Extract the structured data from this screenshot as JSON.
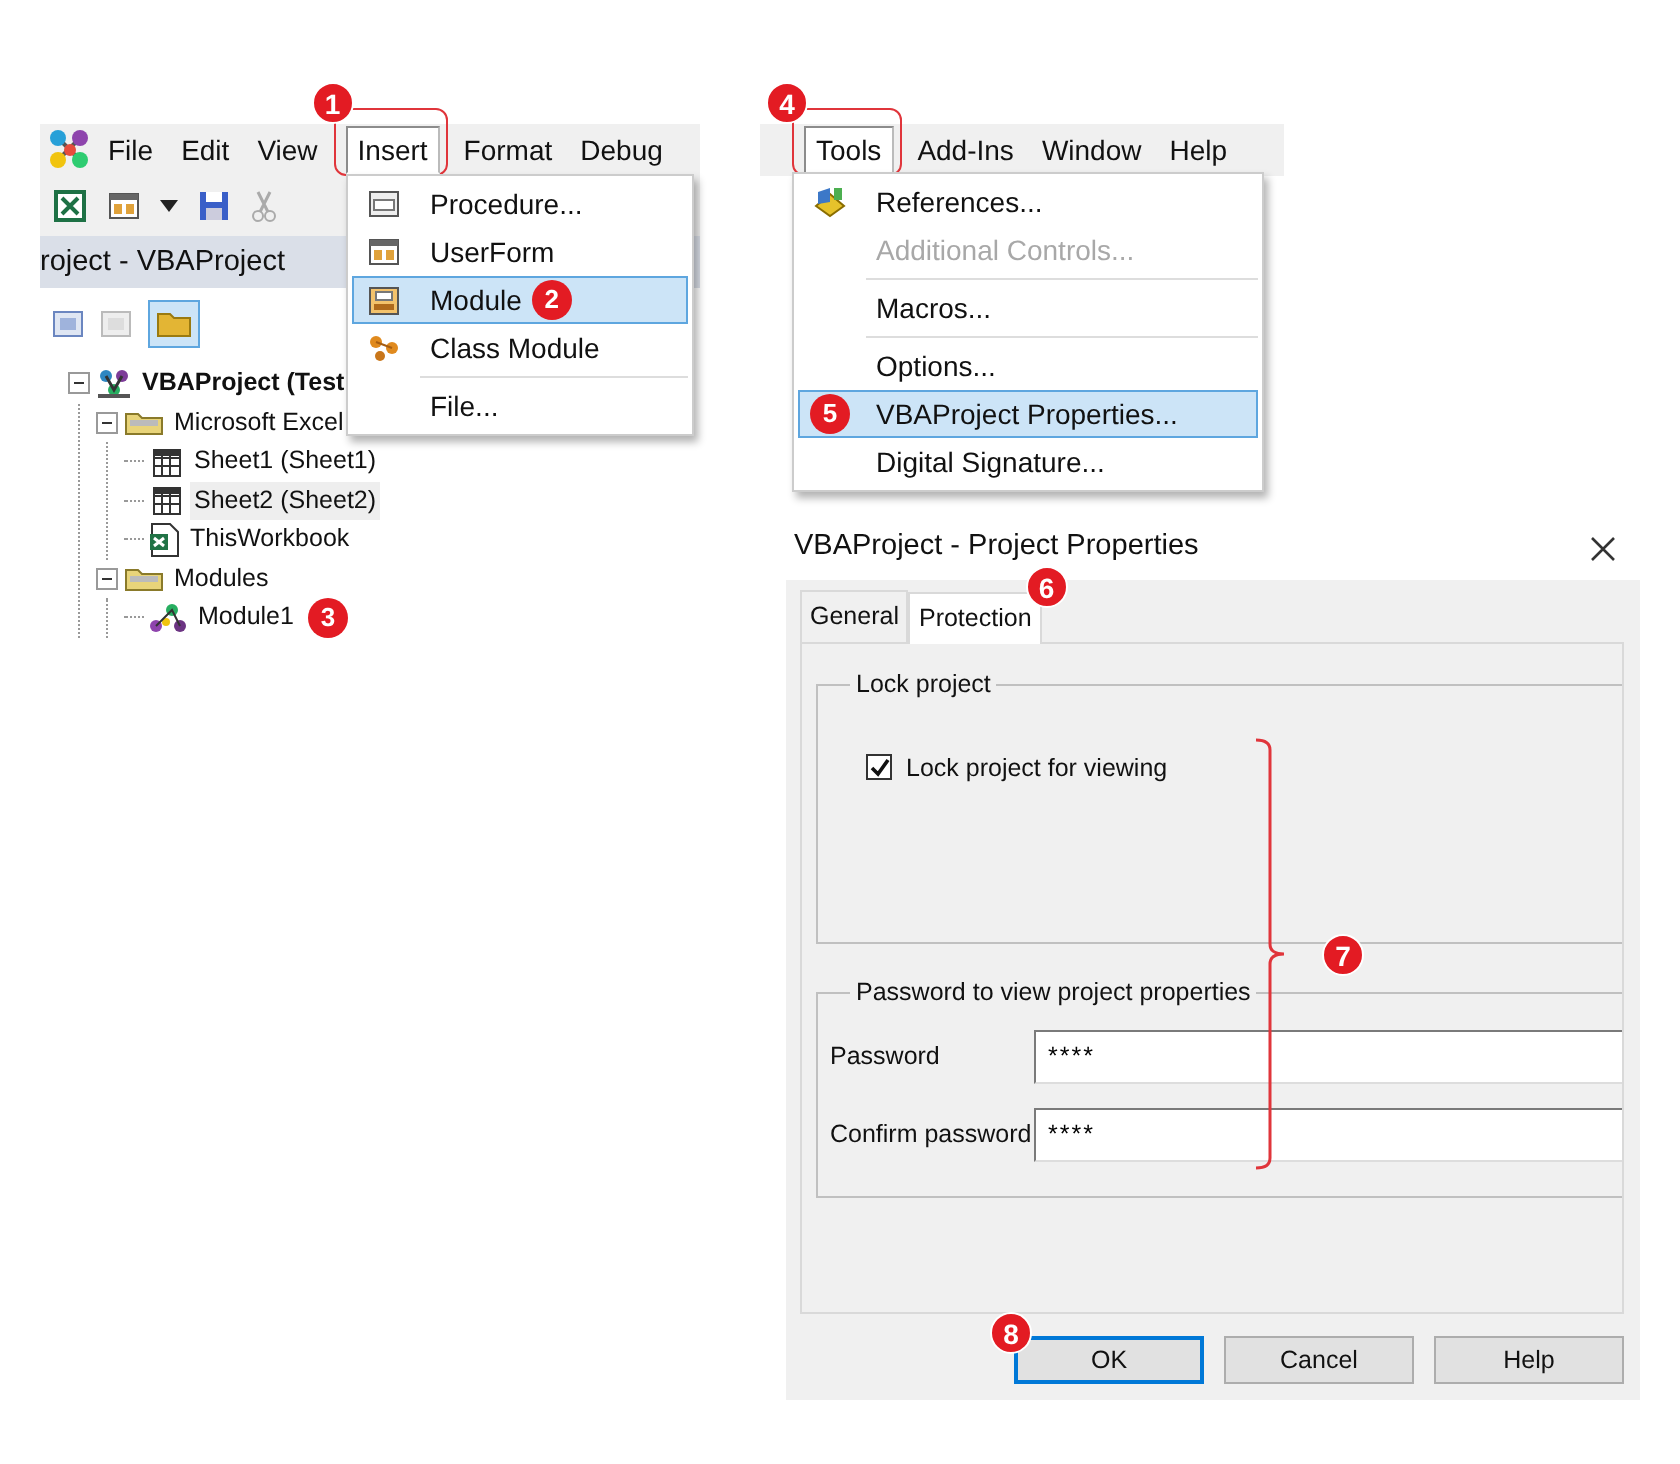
{
  "editor": {
    "menu_bar": [
      {
        "label": "File",
        "open": false
      },
      {
        "label": "Edit",
        "open": false
      },
      {
        "label": "View",
        "open": false
      },
      {
        "label": "Insert",
        "open": true,
        "callout": "1"
      },
      {
        "label": "Format",
        "open": false
      },
      {
        "label": "Debug",
        "open": false
      }
    ],
    "pane_title": "roject - VBAProject",
    "tree": [
      {
        "label": "VBAProject (Test",
        "kind": "project",
        "expanded": true,
        "selected": false,
        "children": [
          {
            "label": "Microsoft Excel",
            "kind": "folder",
            "expanded": true,
            "selected": false,
            "children": [
              {
                "label": "Sheet1 (Sheet1)",
                "kind": "sheet",
                "selected": false
              },
              {
                "label": "Sheet2 (Sheet2)",
                "kind": "sheet",
                "selected": true
              },
              {
                "label": "ThisWorkbook",
                "kind": "workbook",
                "selected": false
              }
            ]
          },
          {
            "label": "Modules",
            "kind": "folder",
            "expanded": true,
            "selected": false,
            "children": [
              {
                "label": "Module1",
                "kind": "module",
                "selected": false,
                "callout": "3"
              }
            ]
          }
        ]
      }
    ],
    "insert_menu": [
      {
        "label": "Procedure...",
        "kind": "procedure",
        "selected": false
      },
      {
        "label": "UserForm",
        "kind": "userform",
        "selected": false
      },
      {
        "label": "Module",
        "kind": "module",
        "selected": true,
        "callout": "2"
      },
      {
        "label": "Class Module",
        "kind": "class",
        "selected": false
      },
      {
        "label": "File...",
        "kind": "file",
        "selected": false,
        "separator": true
      }
    ]
  },
  "tools": {
    "menu_bar": [
      {
        "label": "Tools",
        "open": true,
        "callout": "4"
      },
      {
        "label": "Add-Ins",
        "open": false
      },
      {
        "label": "Window",
        "open": false
      },
      {
        "label": "Help",
        "open": false
      }
    ],
    "menu": [
      {
        "label": "References...",
        "kind": "references",
        "disabled": false,
        "selected": false
      },
      {
        "label": "Additional Controls...",
        "kind": "plain",
        "disabled": true,
        "selected": false
      },
      {
        "label": "Macros...",
        "kind": "plain",
        "disabled": false,
        "selected": false,
        "separator": true
      },
      {
        "label": "Options...",
        "kind": "plain",
        "disabled": false,
        "selected": false,
        "separator": true
      },
      {
        "label": "VBAProject Properties...",
        "kind": "plain",
        "disabled": false,
        "selected": true,
        "callout": "5"
      },
      {
        "label": "Digital Signature...",
        "kind": "plain",
        "disabled": false,
        "selected": false
      }
    ]
  },
  "dialog": {
    "title": "VBAProject - Project Properties",
    "tabs": [
      {
        "label": "General",
        "selected": false
      },
      {
        "label": "Protection",
        "selected": true,
        "callout": "6"
      }
    ],
    "lock_group": {
      "legend": "Lock project",
      "checkbox": {
        "label": "Lock project for viewing",
        "checked": true
      }
    },
    "password_group": {
      "legend": "Password to view project properties",
      "fields": [
        {
          "label": "Password",
          "value": "****"
        },
        {
          "label": "Confirm password",
          "value": "****"
        }
      ]
    },
    "bracket_callout": "7",
    "buttons": [
      {
        "label": "OK",
        "focused": true,
        "callout": "8"
      },
      {
        "label": "Cancel",
        "focused": false
      },
      {
        "label": "Help",
        "focused": false
      }
    ]
  }
}
